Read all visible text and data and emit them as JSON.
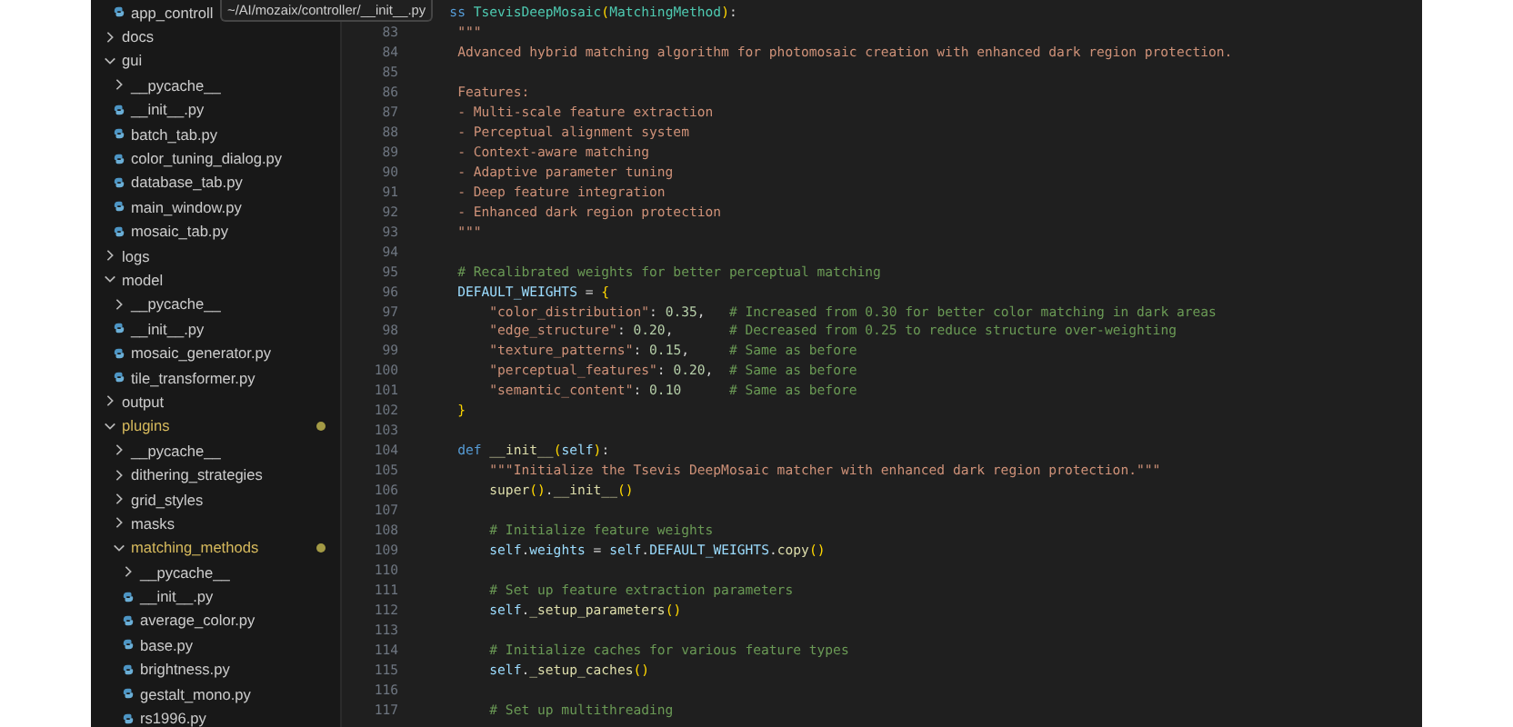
{
  "tooltip": {
    "path": "~/AI/mozaix/controller/__init__.py"
  },
  "sidebar": {
    "cut_row": {
      "name": "app_controll",
      "kind": "file"
    },
    "tree": [
      {
        "name": "docs",
        "kind": "folder",
        "expanded": false,
        "modified": false
      },
      {
        "name": "gui",
        "kind": "folder",
        "expanded": true,
        "modified": false,
        "children": [
          {
            "name": "__pycache__",
            "kind": "folder",
            "expanded": false,
            "modified": false
          },
          {
            "name": "__init__.py",
            "kind": "file",
            "modified": false
          },
          {
            "name": "batch_tab.py",
            "kind": "file",
            "modified": false
          },
          {
            "name": "color_tuning_dialog.py",
            "kind": "file",
            "modified": false
          },
          {
            "name": "database_tab.py",
            "kind": "file",
            "modified": false
          },
          {
            "name": "main_window.py",
            "kind": "file",
            "modified": false
          },
          {
            "name": "mosaic_tab.py",
            "kind": "file",
            "modified": false
          }
        ]
      },
      {
        "name": "logs",
        "kind": "folder",
        "expanded": false,
        "modified": false
      },
      {
        "name": "model",
        "kind": "folder",
        "expanded": true,
        "modified": false,
        "children": [
          {
            "name": "__pycache__",
            "kind": "folder",
            "expanded": false,
            "modified": false
          },
          {
            "name": "__init__.py",
            "kind": "file",
            "modified": false
          },
          {
            "name": "mosaic_generator.py",
            "kind": "file",
            "modified": false
          },
          {
            "name": "tile_transformer.py",
            "kind": "file",
            "modified": false
          }
        ]
      },
      {
        "name": "output",
        "kind": "folder",
        "expanded": false,
        "modified": false
      },
      {
        "name": "plugins",
        "kind": "folder",
        "expanded": true,
        "modified": true,
        "children": [
          {
            "name": "__pycache__",
            "kind": "folder",
            "expanded": false,
            "modified": false
          },
          {
            "name": "dithering_strategies",
            "kind": "folder",
            "expanded": false,
            "modified": false
          },
          {
            "name": "grid_styles",
            "kind": "folder",
            "expanded": false,
            "modified": false
          },
          {
            "name": "masks",
            "kind": "folder",
            "expanded": false,
            "modified": false
          },
          {
            "name": "matching_methods",
            "kind": "folder",
            "expanded": true,
            "modified": true,
            "children": [
              {
                "name": "__pycache__",
                "kind": "folder",
                "expanded": false,
                "modified": false
              },
              {
                "name": "__init__.py",
                "kind": "file",
                "modified": false
              },
              {
                "name": "average_color.py",
                "kind": "file",
                "modified": false
              },
              {
                "name": "base.py",
                "kind": "file",
                "modified": false
              },
              {
                "name": "brightness.py",
                "kind": "file",
                "modified": false
              },
              {
                "name": "gestalt_mono.py",
                "kind": "file",
                "modified": false
              },
              {
                "name": "rs1996.py",
                "kind": "file",
                "modified": false
              }
            ]
          }
        ]
      }
    ]
  },
  "editor": {
    "lines": [
      {
        "tokens": [
          {
            "kind": "keyword",
            "text": "   ss "
          },
          {
            "kind": "class",
            "text": "TsevisDeepMosaic"
          },
          {
            "kind": "bracket",
            "text": "("
          },
          {
            "kind": "class",
            "text": "MatchingMethod"
          },
          {
            "kind": "bracket",
            "text": ")"
          },
          {
            "kind": "plain",
            "text": ":"
          }
        ]
      },
      {
        "number": "83",
        "tokens": [
          {
            "kind": "string",
            "text": "    \"\"\""
          }
        ]
      },
      {
        "number": "84",
        "tokens": [
          {
            "kind": "string",
            "text": "    Advanced hybrid matching algorithm for photomosaic creation with enhanced dark region protection."
          }
        ]
      },
      {
        "number": "85"
      },
      {
        "number": "86",
        "tokens": [
          {
            "kind": "string",
            "text": "    Features:"
          }
        ]
      },
      {
        "number": "87",
        "tokens": [
          {
            "kind": "string",
            "text": "    - Multi-scale feature extraction"
          }
        ]
      },
      {
        "number": "88",
        "tokens": [
          {
            "kind": "string",
            "text": "    - Perceptual alignment system"
          }
        ]
      },
      {
        "number": "89",
        "tokens": [
          {
            "kind": "string",
            "text": "    - Context-aware matching"
          }
        ]
      },
      {
        "number": "90",
        "tokens": [
          {
            "kind": "string",
            "text": "    - Adaptive parameter tuning"
          }
        ]
      },
      {
        "number": "91",
        "tokens": [
          {
            "kind": "string",
            "text": "    - Deep feature integration"
          }
        ]
      },
      {
        "number": "92",
        "tokens": [
          {
            "kind": "string",
            "text": "    - Enhanced dark region protection"
          }
        ]
      },
      {
        "number": "93",
        "tokens": [
          {
            "kind": "string",
            "text": "    \"\"\""
          }
        ]
      },
      {
        "number": "94"
      },
      {
        "number": "95",
        "tokens": [
          {
            "kind": "comment",
            "text": "    # Recalibrated weights for better perceptual matching"
          }
        ]
      },
      {
        "number": "96",
        "tokens": [
          {
            "kind": "variable",
            "text": "    DEFAULT_WEIGHTS"
          },
          {
            "kind": "plain",
            "text": " = "
          },
          {
            "kind": "bracket",
            "text": "{"
          }
        ]
      },
      {
        "number": "97",
        "tokens": [
          {
            "kind": "string",
            "text": "        \"color_distribution\""
          },
          {
            "kind": "plain",
            "text": ": "
          },
          {
            "kind": "number",
            "text": "0.35"
          },
          {
            "kind": "plain",
            "text": ",   "
          },
          {
            "kind": "comment",
            "text": "# Increased from 0.30 for better color matching in dark areas"
          }
        ]
      },
      {
        "number": "98",
        "tokens": [
          {
            "kind": "string",
            "text": "        \"edge_structure\""
          },
          {
            "kind": "plain",
            "text": ": "
          },
          {
            "kind": "number",
            "text": "0.20"
          },
          {
            "kind": "plain",
            "text": ",       "
          },
          {
            "kind": "comment",
            "text": "# Decreased from 0.25 to reduce structure over-weighting"
          }
        ]
      },
      {
        "number": "99",
        "tokens": [
          {
            "kind": "string",
            "text": "        \"texture_patterns\""
          },
          {
            "kind": "plain",
            "text": ": "
          },
          {
            "kind": "number",
            "text": "0.15"
          },
          {
            "kind": "plain",
            "text": ",     "
          },
          {
            "kind": "comment",
            "text": "# Same as before"
          }
        ]
      },
      {
        "number": "100",
        "tokens": [
          {
            "kind": "string",
            "text": "        \"perceptual_features\""
          },
          {
            "kind": "plain",
            "text": ": "
          },
          {
            "kind": "number",
            "text": "0.20"
          },
          {
            "kind": "plain",
            "text": ",  "
          },
          {
            "kind": "comment",
            "text": "# Same as before"
          }
        ]
      },
      {
        "number": "101",
        "tokens": [
          {
            "kind": "string",
            "text": "        \"semantic_content\""
          },
          {
            "kind": "plain",
            "text": ": "
          },
          {
            "kind": "number",
            "text": "0.10"
          },
          {
            "kind": "comment",
            "text": "      # Same as before"
          }
        ]
      },
      {
        "number": "102",
        "tokens": [
          {
            "kind": "bracket",
            "text": "    }"
          }
        ]
      },
      {
        "number": "103"
      },
      {
        "number": "104",
        "tokens": [
          {
            "kind": "keyword",
            "text": "    def "
          },
          {
            "kind": "function",
            "text": "__init__"
          },
          {
            "kind": "bracket",
            "text": "("
          },
          {
            "kind": "variable",
            "text": "self"
          },
          {
            "kind": "bracket",
            "text": ")"
          },
          {
            "kind": "plain",
            "text": ":"
          }
        ]
      },
      {
        "number": "105",
        "tokens": [
          {
            "kind": "string",
            "text": "        \"\"\"Initialize the Tsevis DeepMosaic matcher with enhanced dark region protection.\"\"\""
          }
        ]
      },
      {
        "number": "106",
        "tokens": [
          {
            "kind": "function",
            "text": "        super"
          },
          {
            "kind": "bracket",
            "text": "()"
          },
          {
            "kind": "plain",
            "text": "."
          },
          {
            "kind": "function",
            "text": "__init__"
          },
          {
            "kind": "bracket",
            "text": "()"
          }
        ]
      },
      {
        "number": "107"
      },
      {
        "number": "108",
        "tokens": [
          {
            "kind": "comment",
            "text": "        # Initialize feature weights"
          }
        ]
      },
      {
        "number": "109",
        "tokens": [
          {
            "kind": "variable",
            "text": "        self"
          },
          {
            "kind": "plain",
            "text": "."
          },
          {
            "kind": "variable",
            "text": "weights"
          },
          {
            "kind": "plain",
            "text": " = "
          },
          {
            "kind": "variable",
            "text": "self"
          },
          {
            "kind": "plain",
            "text": "."
          },
          {
            "kind": "variable",
            "text": "DEFAULT_WEIGHTS"
          },
          {
            "kind": "plain",
            "text": "."
          },
          {
            "kind": "function",
            "text": "copy"
          },
          {
            "kind": "bracket",
            "text": "()"
          }
        ]
      },
      {
        "number": "110"
      },
      {
        "number": "111",
        "tokens": [
          {
            "kind": "comment",
            "text": "        # Set up feature extraction parameters"
          }
        ]
      },
      {
        "number": "112",
        "tokens": [
          {
            "kind": "variable",
            "text": "        self"
          },
          {
            "kind": "plain",
            "text": "."
          },
          {
            "kind": "function",
            "text": "_setup_parameters"
          },
          {
            "kind": "bracket",
            "text": "()"
          }
        ]
      },
      {
        "number": "113"
      },
      {
        "number": "114",
        "tokens": [
          {
            "kind": "comment",
            "text": "        # Initialize caches for various feature types"
          }
        ]
      },
      {
        "number": "115",
        "tokens": [
          {
            "kind": "variable",
            "text": "        self"
          },
          {
            "kind": "plain",
            "text": "."
          },
          {
            "kind": "function",
            "text": "_setup_caches"
          },
          {
            "kind": "bracket",
            "text": "()"
          }
        ]
      },
      {
        "number": "116"
      },
      {
        "number": "117",
        "tokens": [
          {
            "kind": "comment",
            "text": "        # Set up multithreading"
          }
        ]
      }
    ]
  }
}
